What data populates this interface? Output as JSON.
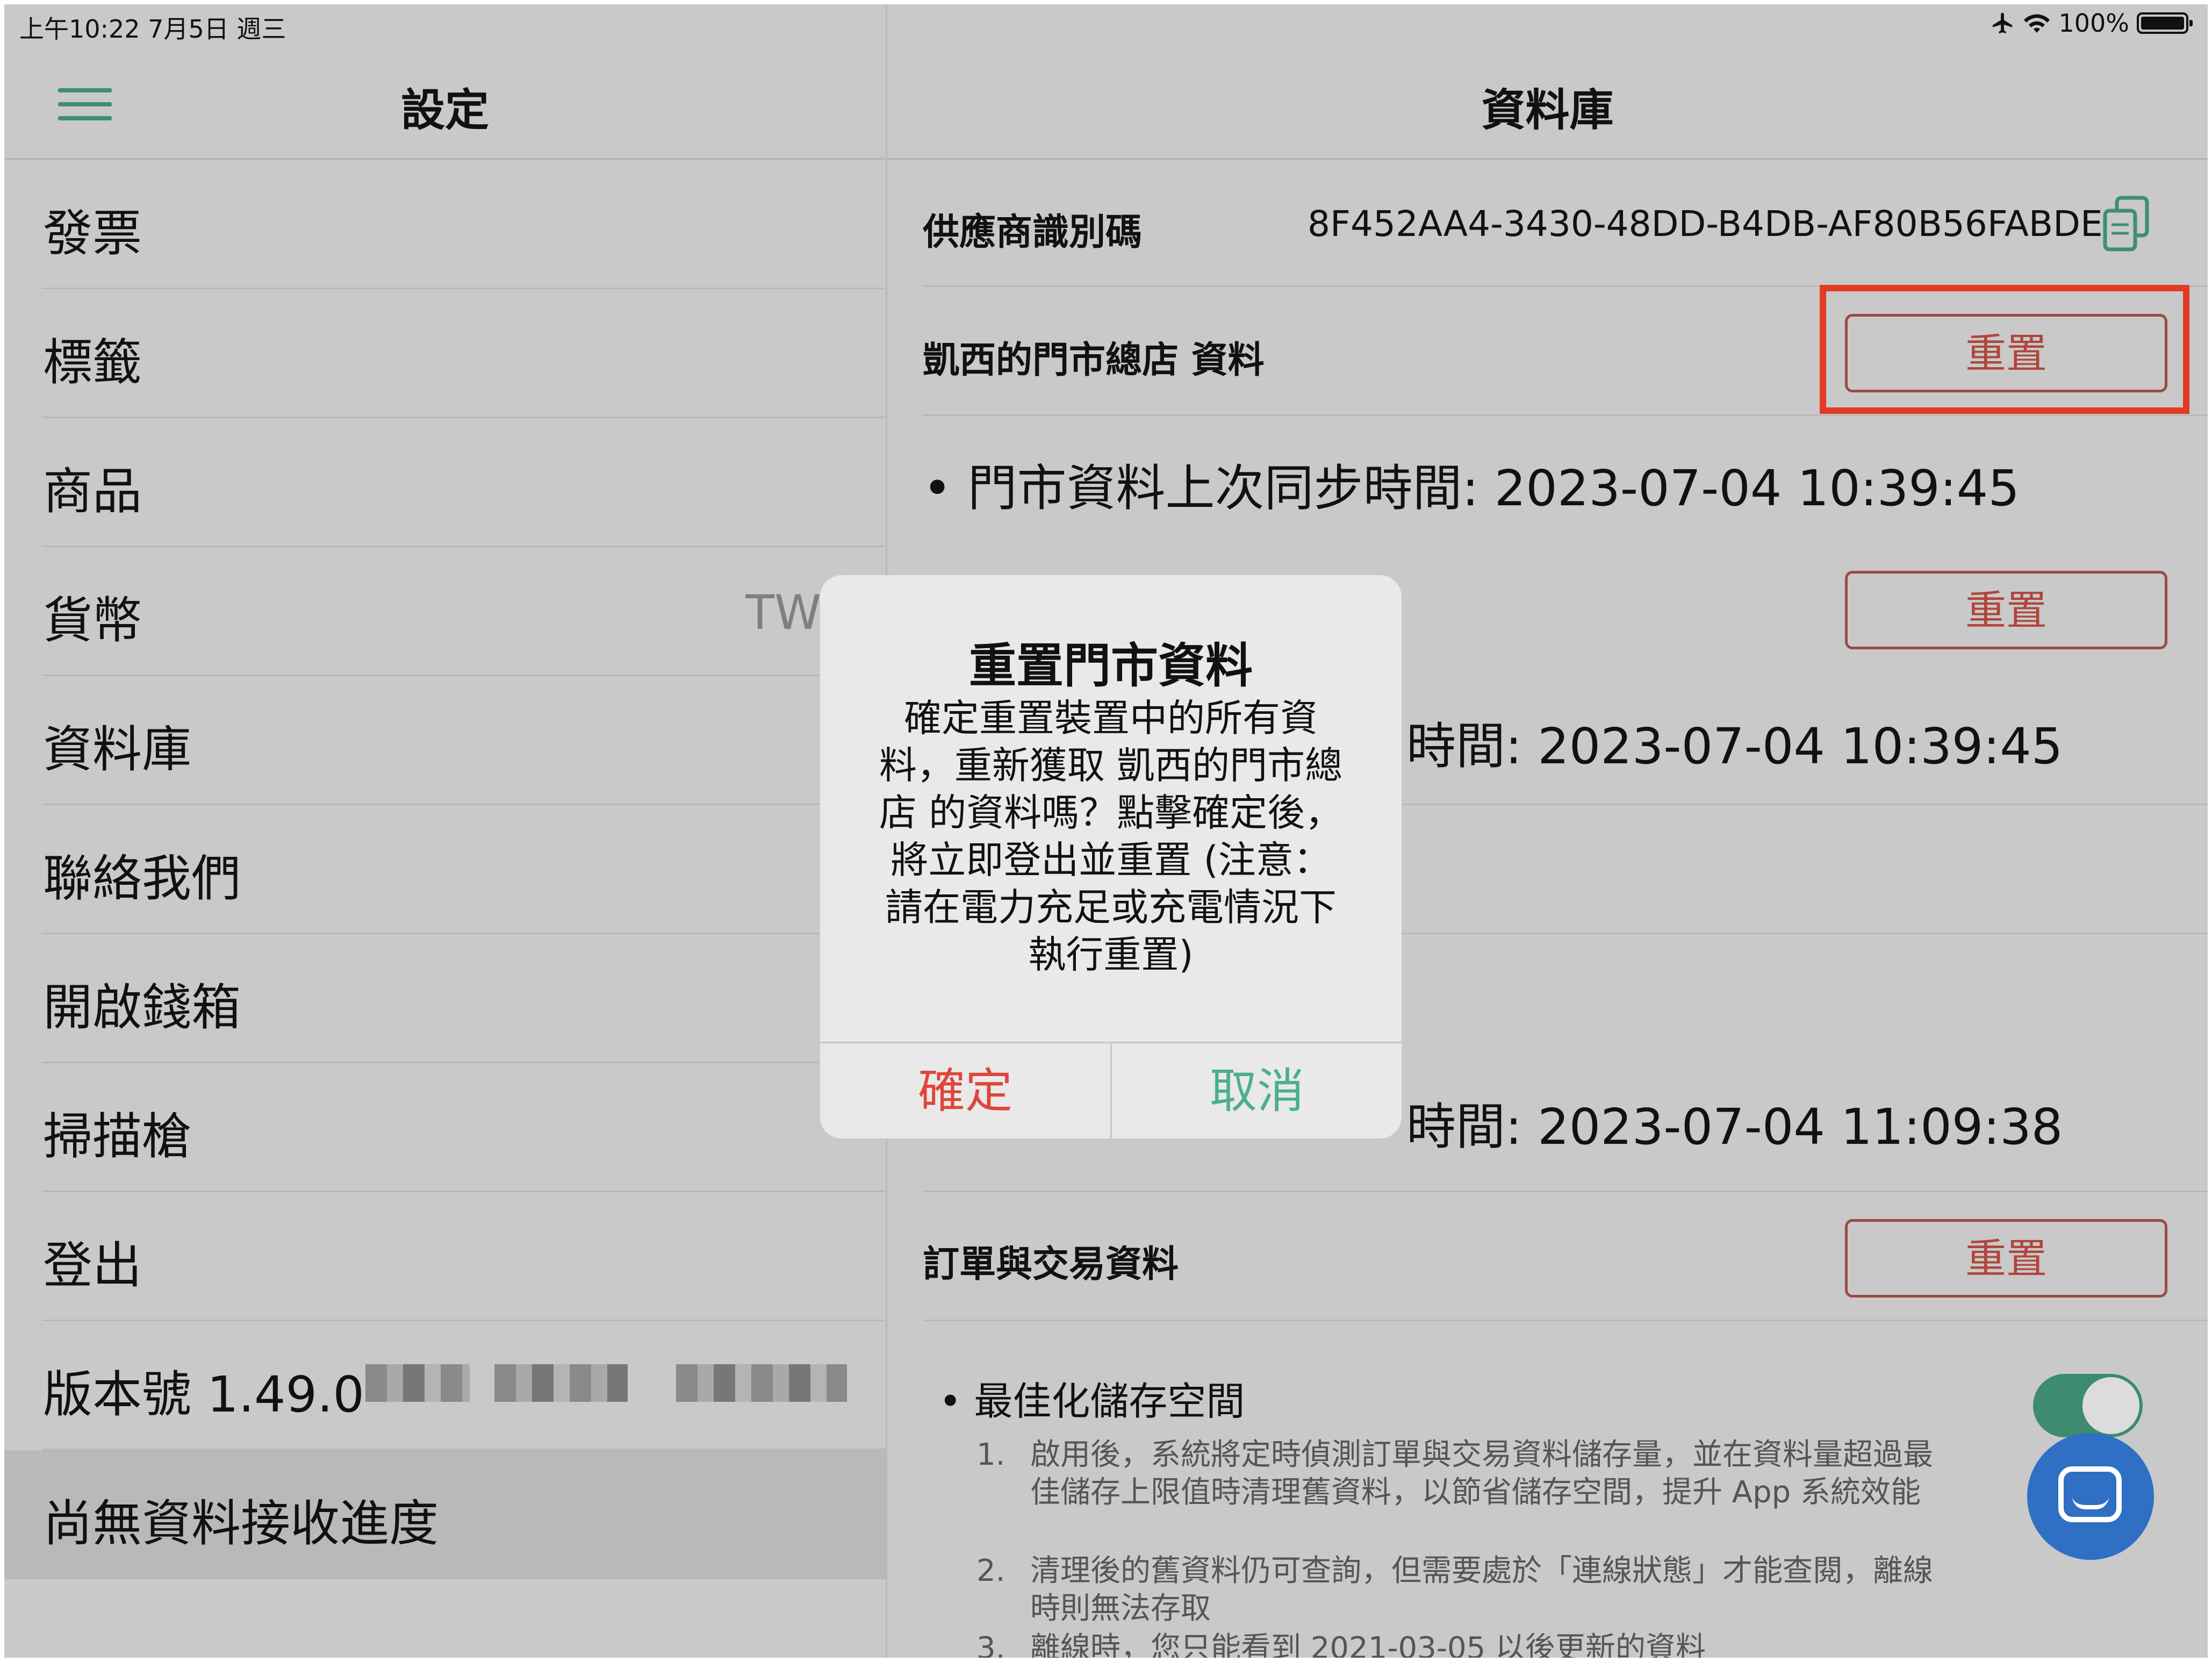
{
  "status_bar": {
    "time_date": "上午10:22   7月5日 週三",
    "airplane_icon": "airplane-icon",
    "wifi_icon": "wifi-icon",
    "battery": "100%"
  },
  "left": {
    "title": "設定",
    "menu": [
      {
        "label": "發票"
      },
      {
        "label": "標籤"
      },
      {
        "label": "商品"
      },
      {
        "label": "貨幣",
        "value": "TW"
      },
      {
        "label": "資料庫"
      },
      {
        "label": "聯絡我們"
      },
      {
        "label": "開啟錢箱"
      },
      {
        "label": "掃描槍"
      },
      {
        "label": "登出"
      },
      {
        "label": "版本號 1.49.0"
      },
      {
        "label": "尚無資料接收進度"
      }
    ]
  },
  "right": {
    "title": "資料庫",
    "vendor_label": "供應商識別碼",
    "vendor_id": "8F452AA4-3430-48DD-B4DB-AF80B56FABDE",
    "store_section_label": "凱西的門市總店 資料",
    "reset_label": "重置",
    "store_sync": "• 門市資料上次同步時間:  2023-07-04 10:39:45",
    "sync2": "時間:  2023-07-04 10:39:45",
    "sync3": "時間:  2023-07-04 11:09:38",
    "orders_label": "訂單與交易資料",
    "optimize_label": "• 最佳化儲存空間",
    "optimize_enabled": true,
    "notes": [
      {
        "n": "1.",
        "text": "啟用後，系統將定時偵測訂單與交易資料儲存量，並在資料量超過最佳儲存上限值時清理舊資料，以節省儲存空間，提升 App 系統效能"
      },
      {
        "n": "2.",
        "text": "清理後的舊資料仍可查詢，但需要處於「連線狀態」才能查閱，離線時則無法存取"
      },
      {
        "n": "3.",
        "text": "離線時，您只能看到 2021-03-05 以後更新的資料"
      }
    ]
  },
  "dialog": {
    "title": "重置門市資料",
    "message": "確定重置裝置中的所有資\n料，重新獲取 凱西的門市總\n店 的資料嗎？點擊確定後，\n將立即登出並重置 (注意：\n請在電力充足或充電情況下\n執行重置)",
    "confirm": "確定",
    "cancel": "取消",
    "confirm_color": "#e0453a",
    "cancel_color": "#4bb08a"
  },
  "colors": {
    "accent_green": "#3f8f72",
    "reset_red": "#b0463b",
    "highlight_red": "#e23a24",
    "fab_blue": "#2f6fc4"
  }
}
